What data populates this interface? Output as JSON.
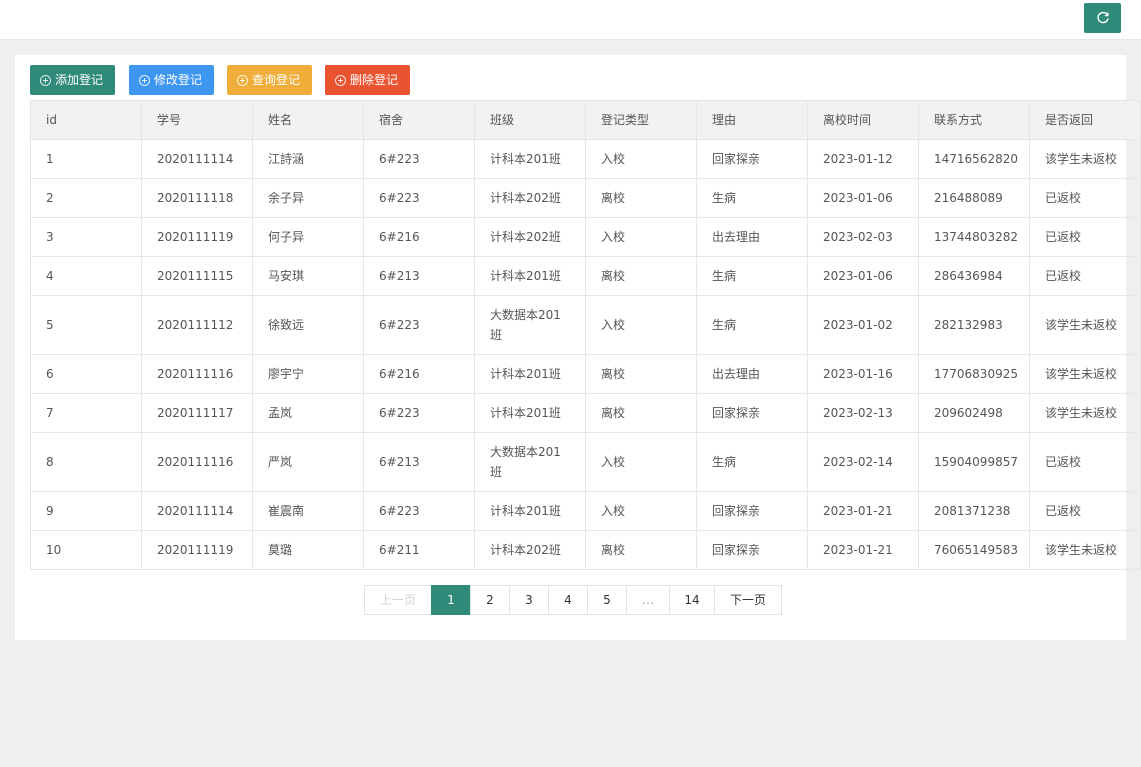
{
  "toolbar": {
    "add_label": "添加登记",
    "edit_label": "修改登记",
    "query_label": "查询登记",
    "delete_label": "删除登记"
  },
  "colors": {
    "primary": "#2f8a7a",
    "edit": "#3d96ef",
    "query": "#efad3a",
    "delete": "#e9532f"
  },
  "table": {
    "columns": [
      "id",
      "学号",
      "姓名",
      "宿舍",
      "班级",
      "登记类型",
      "理由",
      "离校时间",
      "联系方式",
      "是否返回"
    ],
    "rows": [
      [
        "1",
        "2020111114",
        "江詩涵",
        "6#223",
        "计科本201班",
        "入校",
        "回家探亲",
        "2023-01-12",
        "14716562820",
        "该学生未返校"
      ],
      [
        "2",
        "2020111118",
        "余子异",
        "6#223",
        "计科本202班",
        "离校",
        "生病",
        "2023-01-06",
        "216488089",
        "已返校"
      ],
      [
        "3",
        "2020111119",
        "何子异",
        "6#216",
        "计科本202班",
        "入校",
        "出去理由",
        "2023-02-03",
        "13744803282",
        "已返校"
      ],
      [
        "4",
        "2020111115",
        "马安琪",
        "6#213",
        "计科本201班",
        "离校",
        "生病",
        "2023-01-06",
        "286436984",
        "已返校"
      ],
      [
        "5",
        "2020111112",
        "徐致远",
        "6#223",
        "大数据本201班",
        "入校",
        "生病",
        "2023-01-02",
        "282132983",
        "该学生未返校"
      ],
      [
        "6",
        "2020111116",
        "廖宇宁",
        "6#216",
        "计科本201班",
        "离校",
        "出去理由",
        "2023-01-16",
        "17706830925",
        "该学生未返校"
      ],
      [
        "7",
        "2020111117",
        "孟岚",
        "6#223",
        "计科本201班",
        "离校",
        "回家探亲",
        "2023-02-13",
        "209602498",
        "该学生未返校"
      ],
      [
        "8",
        "2020111116",
        "严岚",
        "6#213",
        "大数据本201班",
        "入校",
        "生病",
        "2023-02-14",
        "15904099857",
        "已返校"
      ],
      [
        "9",
        "2020111114",
        "崔震南",
        "6#223",
        "计科本201班",
        "入校",
        "回家探亲",
        "2023-01-21",
        "2081371238",
        "已返校"
      ],
      [
        "10",
        "2020111119",
        "莫璐",
        "6#211",
        "计科本202班",
        "离校",
        "回家探亲",
        "2023-01-21",
        "76065149583",
        "该学生未返校"
      ]
    ]
  },
  "pagination": {
    "prev_label": "上一页",
    "next_label": "下一页",
    "current": 1,
    "pages": [
      "1",
      "2",
      "3",
      "4",
      "5",
      "…",
      "14"
    ]
  },
  "icons": {
    "refresh": "refresh-icon",
    "add": "plus-circle-icon"
  }
}
